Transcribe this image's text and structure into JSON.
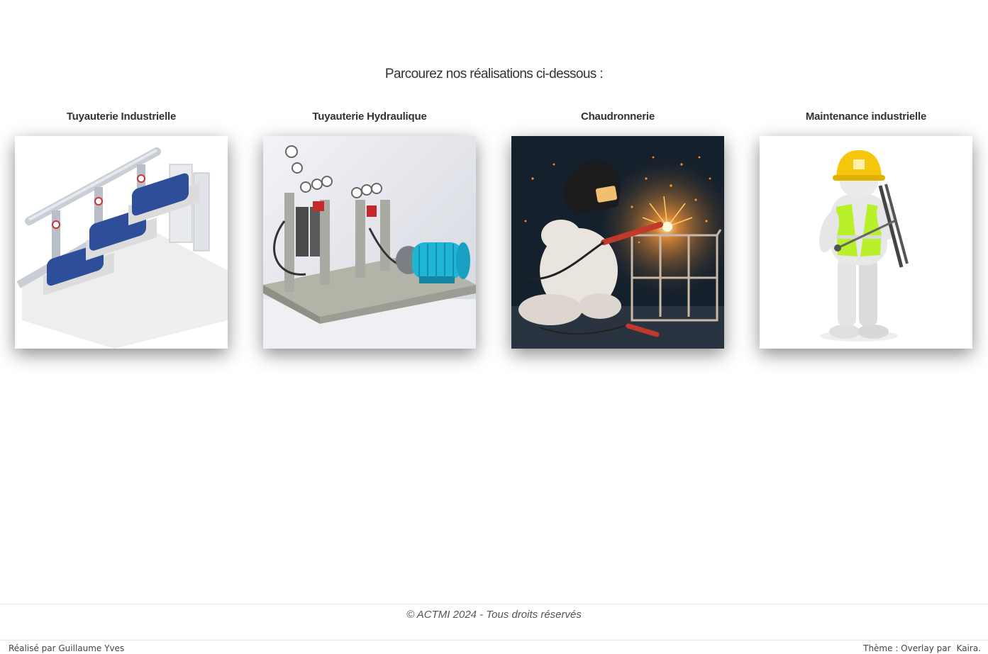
{
  "intro": {
    "text": "Parcourez nos réalisations ci-dessous :"
  },
  "cards": [
    {
      "title": "Tuyauterie Industrielle",
      "image_icon": "pump-piping-illustration-icon"
    },
    {
      "title": "Tuyauterie Hydraulique",
      "image_icon": "hydraulic-unit-illustration-icon"
    },
    {
      "title": "Chaudronnerie",
      "image_icon": "welder-illustration-icon"
    },
    {
      "title": "Maintenance industrielle",
      "image_icon": "maintenance-worker-illustration-icon"
    }
  ],
  "footer": {
    "copyright": "© ACTMI 2024 - Tous droits réservés",
    "credit": "Réalisé par Guillaume Yves",
    "theme_prefix": "Thème : Overlay par",
    "theme_author": "Kaira."
  },
  "colors": {
    "pump_blue": "#2e4e9a",
    "motor_cyan": "#1fb6d6",
    "helmet_yellow": "#f5c60c",
    "vest_green": "#b8f02a",
    "welding_bg": "#14202c",
    "spark_orange": "#ff8c2a"
  }
}
